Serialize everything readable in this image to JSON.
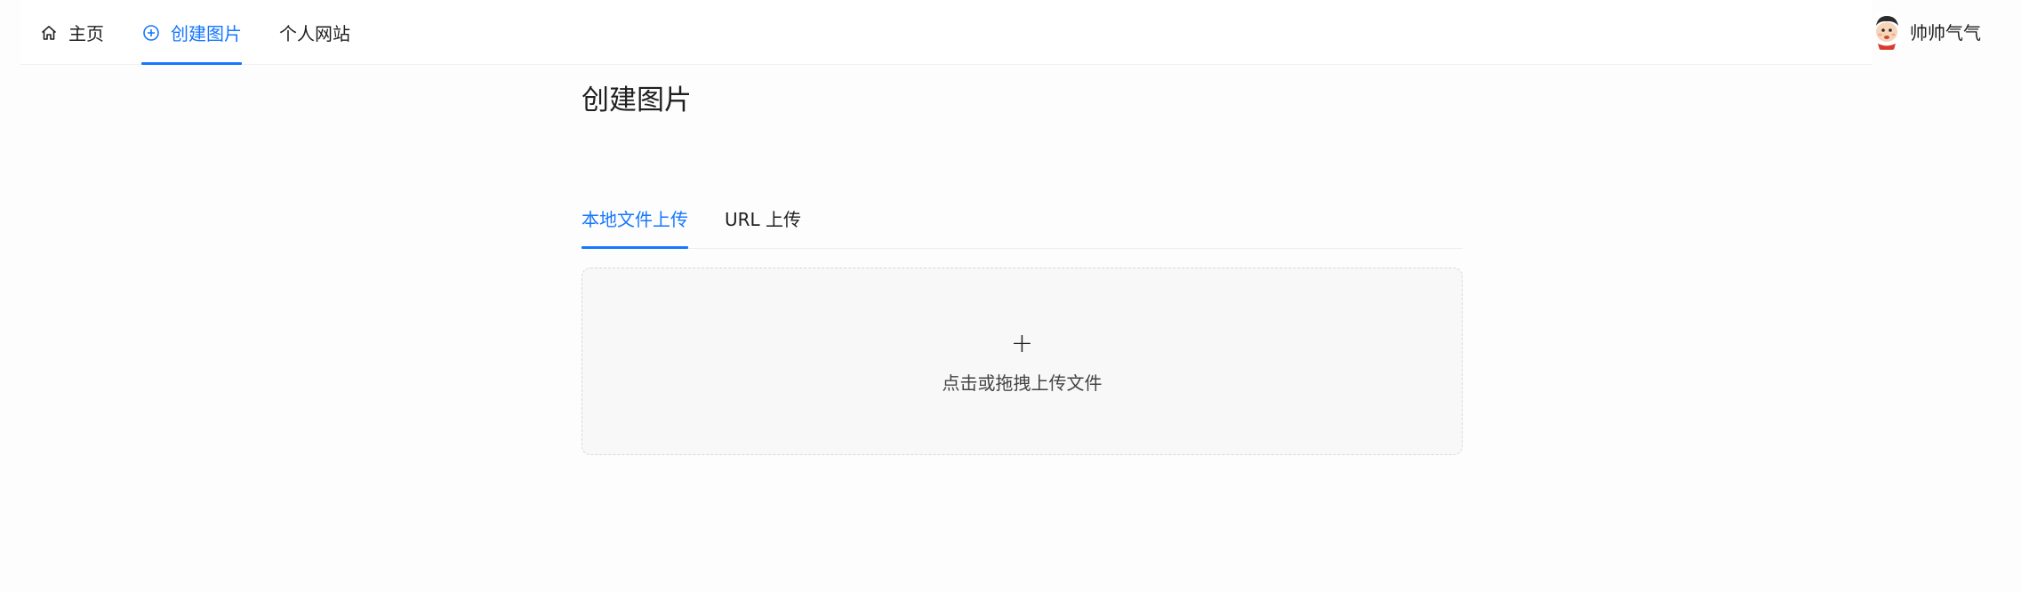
{
  "nav": {
    "items": [
      {
        "label": "主页",
        "icon": "home-icon"
      },
      {
        "label": "创建图片",
        "icon": "plus-circle-icon"
      },
      {
        "label": "个人网站"
      }
    ],
    "accent_color": "#1677ff"
  },
  "user": {
    "name": "帅帅气气"
  },
  "page": {
    "title": "创建图片",
    "tabs": [
      {
        "label": "本地文件上传"
      },
      {
        "label": "URL 上传"
      }
    ],
    "upload": {
      "icon": "+",
      "hint": "点击或拖拽上传文件"
    }
  }
}
